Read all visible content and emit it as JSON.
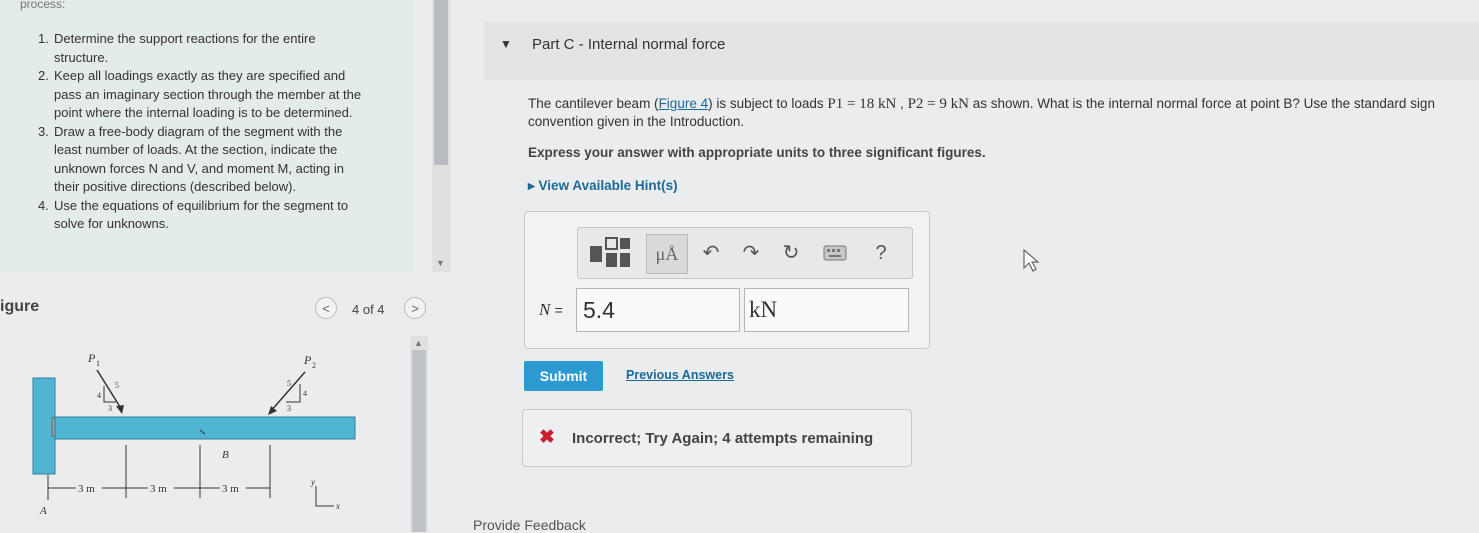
{
  "left_panel": {
    "process_label": "process:",
    "steps": [
      {
        "num": "1.",
        "text": "Determine the support reactions for the entire structure."
      },
      {
        "num": "2.",
        "text": "Keep all loadings exactly as they are specified and pass an imaginary section through the member at the point where the internal loading is to be determined."
      },
      {
        "num": "3.",
        "text": "Draw a free-body diagram of the segment with the least number of loads. At the section, indicate the unknown forces N and V, and moment M, acting in their positive directions (described below)."
      },
      {
        "num": "4.",
        "text": "Use the equations of equilibrium for the segment to solve for unknowns."
      }
    ]
  },
  "figure": {
    "label": "igure",
    "counter": "4 of 4",
    "prev_icon": "chevron-left-icon",
    "next_icon": "chevron-right-icon",
    "labels": {
      "p1": "P",
      "p1_sub": "1",
      "p2": "P",
      "p2_sub": "2",
      "tri_left_top": "5",
      "tri_left_side": "4",
      "tri_left_bottom": "3",
      "tri_right_top": "5",
      "tri_right_side": "4",
      "tri_right_bottom": "3",
      "point_b": "B",
      "point_a": "A",
      "dim1": "3 m",
      "dim2": "3 m",
      "dim3": "3 m",
      "axis_y": "y",
      "axis_x": "x"
    }
  },
  "part_c": {
    "title": "Part C - Internal normal force",
    "problem_prefix": "The cantilever beam (",
    "figure_link": "Figure 4",
    "problem_mid": ") is subject to loads ",
    "load1": "P1 = 18 kN",
    "sep": " , ",
    "load2": "P2 = 9 kN",
    "problem_suffix": " as shown. What is the internal normal force at point B? Use the standard sign convention given in the Introduction.",
    "express": "Express your answer with appropriate units to three significant figures.",
    "hints": "View Available Hint(s)"
  },
  "answer": {
    "variable": "N",
    "equals": "=",
    "value": "5.4",
    "units": "kN",
    "toolbar": {
      "units_label": "μÅ",
      "undo": "↶",
      "redo": "↷",
      "reset": "↻",
      "help": "?"
    },
    "submit_label": "Submit",
    "previous_answers": "Previous Answers"
  },
  "feedback": {
    "icon": "✖",
    "message": "Incorrect; Try Again; 4 attempts remaining",
    "provide_feedback": "Provide Feedback"
  },
  "colors": {
    "beam": "#4fb5d3",
    "submit": "#2c9ad0",
    "error": "#c8202f",
    "link": "#1a6a9a"
  }
}
